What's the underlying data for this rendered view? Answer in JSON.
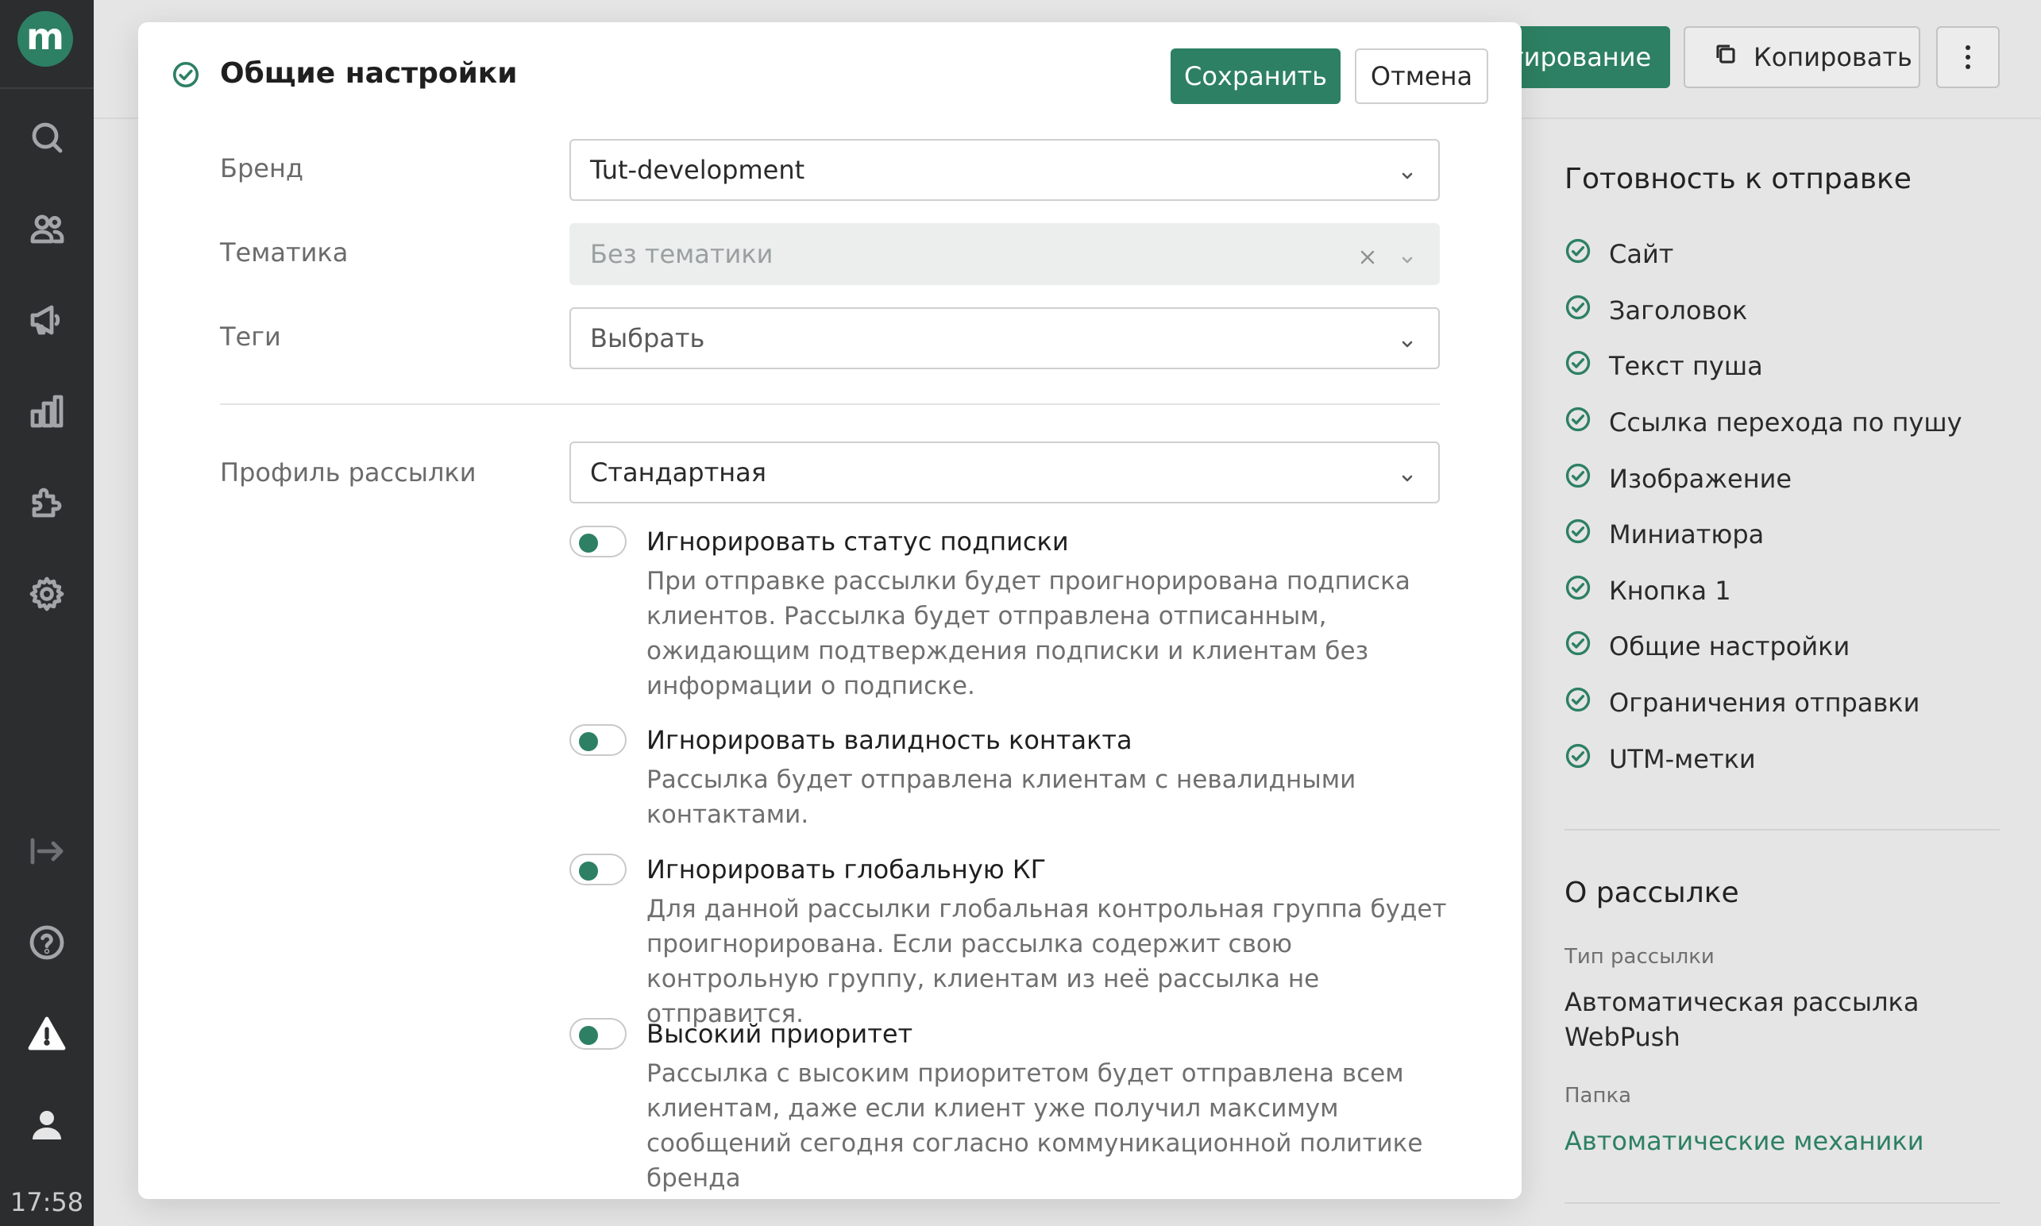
{
  "sidebar": {
    "logo": "m",
    "clock": "17:58",
    "icons": [
      "search-icon",
      "users-icon",
      "megaphone-icon",
      "chart-icon",
      "puzzle-icon",
      "gear-icon",
      "logout-icon",
      "help-icon",
      "warning-icon",
      "user-icon"
    ]
  },
  "header": {
    "edit_label": "тирование",
    "copy_label": "Копировать"
  },
  "modal": {
    "title": "Общие настройки",
    "save_label": "Сохранить",
    "cancel_label": "Отмена",
    "fields": {
      "brand": {
        "label": "Бренд",
        "value": "Tut-development"
      },
      "topic": {
        "label": "Тематика",
        "value": "Без тематики"
      },
      "tags": {
        "label": "Теги",
        "value": "Выбрать"
      },
      "profile": {
        "label": "Профиль рассылки",
        "value": "Стандартная"
      }
    },
    "toggles": [
      {
        "title": "Игнорировать статус подписки",
        "description": "При отправке рассылки будет проигнорирована подписка клиентов. Рассылка будет отправлена отписанным, ожидающим подтверждения подписки и клиентам без информации о подписке.",
        "enabled": true
      },
      {
        "title": "Игнорировать валидность контакта",
        "description": "Рассылка будет отправлена клиентам с невалидными контактами.",
        "enabled": true
      },
      {
        "title": "Игнорировать глобальную КГ",
        "description": "Для данной рассылки глобальная контрольная группа будет проигнорирована. Если рассылка содержит свою контрольную группу, клиентам из неё рассылка не отправится.",
        "enabled": true
      },
      {
        "title": "Высокий приоритет",
        "description": "Рассылка с высоким приоритетом будет отправлена всем клиентам, даже если клиент уже получил максимум сообщений сегодня согласно коммуникационной политике бренда",
        "enabled": true
      }
    ]
  },
  "readiness": {
    "title": "Готовность к отправке",
    "items": [
      "Сайт",
      "Заголовок",
      "Текст пуша",
      "Ссылка перехода по пушу",
      "Изображение",
      "Миниатюра",
      "Кнопка 1",
      "Общие настройки",
      "Ограничения отправки",
      "UTM-метки"
    ]
  },
  "about": {
    "title": "О рассылке",
    "type_label": "Тип рассылки",
    "type_value": "Автоматическая рассылка WebPush",
    "folder_label": "Папка",
    "folder_value": "Автоматические механики"
  },
  "colors": {
    "accent": "#2d8063",
    "sidebar": "#2b2d2f"
  }
}
